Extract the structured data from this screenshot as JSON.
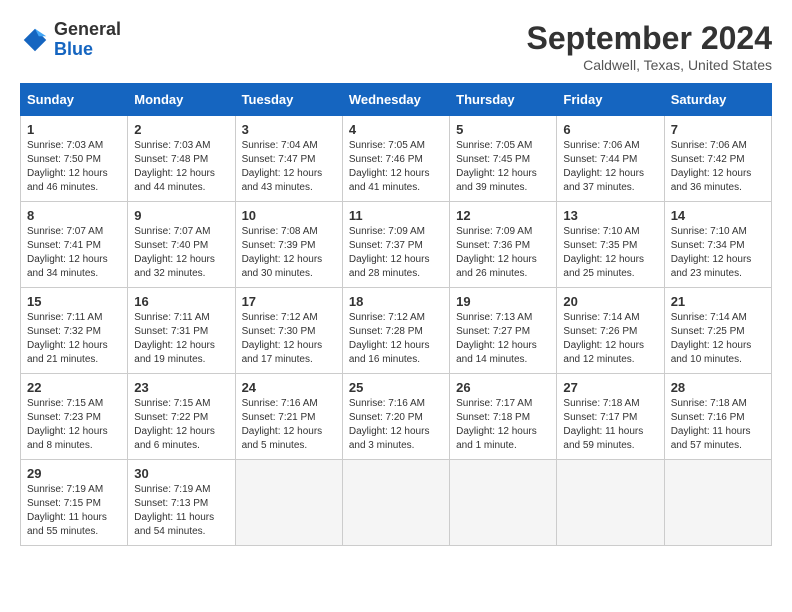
{
  "header": {
    "logo": {
      "general": "General",
      "blue": "Blue"
    },
    "title": "September 2024",
    "location": "Caldwell, Texas, United States"
  },
  "calendar": {
    "days_of_week": [
      "Sunday",
      "Monday",
      "Tuesday",
      "Wednesday",
      "Thursday",
      "Friday",
      "Saturday"
    ],
    "weeks": [
      [
        {
          "day": "1",
          "sunrise": "7:03 AM",
          "sunset": "7:50 PM",
          "daylight": "12 hours and 46 minutes."
        },
        {
          "day": "2",
          "sunrise": "7:03 AM",
          "sunset": "7:48 PM",
          "daylight": "12 hours and 44 minutes."
        },
        {
          "day": "3",
          "sunrise": "7:04 AM",
          "sunset": "7:47 PM",
          "daylight": "12 hours and 43 minutes."
        },
        {
          "day": "4",
          "sunrise": "7:05 AM",
          "sunset": "7:46 PM",
          "daylight": "12 hours and 41 minutes."
        },
        {
          "day": "5",
          "sunrise": "7:05 AM",
          "sunset": "7:45 PM",
          "daylight": "12 hours and 39 minutes."
        },
        {
          "day": "6",
          "sunrise": "7:06 AM",
          "sunset": "7:44 PM",
          "daylight": "12 hours and 37 minutes."
        },
        {
          "day": "7",
          "sunrise": "7:06 AM",
          "sunset": "7:42 PM",
          "daylight": "12 hours and 36 minutes."
        }
      ],
      [
        {
          "day": "8",
          "sunrise": "7:07 AM",
          "sunset": "7:41 PM",
          "daylight": "12 hours and 34 minutes."
        },
        {
          "day": "9",
          "sunrise": "7:07 AM",
          "sunset": "7:40 PM",
          "daylight": "12 hours and 32 minutes."
        },
        {
          "day": "10",
          "sunrise": "7:08 AM",
          "sunset": "7:39 PM",
          "daylight": "12 hours and 30 minutes."
        },
        {
          "day": "11",
          "sunrise": "7:09 AM",
          "sunset": "7:37 PM",
          "daylight": "12 hours and 28 minutes."
        },
        {
          "day": "12",
          "sunrise": "7:09 AM",
          "sunset": "7:36 PM",
          "daylight": "12 hours and 26 minutes."
        },
        {
          "day": "13",
          "sunrise": "7:10 AM",
          "sunset": "7:35 PM",
          "daylight": "12 hours and 25 minutes."
        },
        {
          "day": "14",
          "sunrise": "7:10 AM",
          "sunset": "7:34 PM",
          "daylight": "12 hours and 23 minutes."
        }
      ],
      [
        {
          "day": "15",
          "sunrise": "7:11 AM",
          "sunset": "7:32 PM",
          "daylight": "12 hours and 21 minutes."
        },
        {
          "day": "16",
          "sunrise": "7:11 AM",
          "sunset": "7:31 PM",
          "daylight": "12 hours and 19 minutes."
        },
        {
          "day": "17",
          "sunrise": "7:12 AM",
          "sunset": "7:30 PM",
          "daylight": "12 hours and 17 minutes."
        },
        {
          "day": "18",
          "sunrise": "7:12 AM",
          "sunset": "7:28 PM",
          "daylight": "12 hours and 16 minutes."
        },
        {
          "day": "19",
          "sunrise": "7:13 AM",
          "sunset": "7:27 PM",
          "daylight": "12 hours and 14 minutes."
        },
        {
          "day": "20",
          "sunrise": "7:14 AM",
          "sunset": "7:26 PM",
          "daylight": "12 hours and 12 minutes."
        },
        {
          "day": "21",
          "sunrise": "7:14 AM",
          "sunset": "7:25 PM",
          "daylight": "12 hours and 10 minutes."
        }
      ],
      [
        {
          "day": "22",
          "sunrise": "7:15 AM",
          "sunset": "7:23 PM",
          "daylight": "12 hours and 8 minutes."
        },
        {
          "day": "23",
          "sunrise": "7:15 AM",
          "sunset": "7:22 PM",
          "daylight": "12 hours and 6 minutes."
        },
        {
          "day": "24",
          "sunrise": "7:16 AM",
          "sunset": "7:21 PM",
          "daylight": "12 hours and 5 minutes."
        },
        {
          "day": "25",
          "sunrise": "7:16 AM",
          "sunset": "7:20 PM",
          "daylight": "12 hours and 3 minutes."
        },
        {
          "day": "26",
          "sunrise": "7:17 AM",
          "sunset": "7:18 PM",
          "daylight": "12 hours and 1 minute."
        },
        {
          "day": "27",
          "sunrise": "7:18 AM",
          "sunset": "7:17 PM",
          "daylight": "11 hours and 59 minutes."
        },
        {
          "day": "28",
          "sunrise": "7:18 AM",
          "sunset": "7:16 PM",
          "daylight": "11 hours and 57 minutes."
        }
      ],
      [
        {
          "day": "29",
          "sunrise": "7:19 AM",
          "sunset": "7:15 PM",
          "daylight": "11 hours and 55 minutes."
        },
        {
          "day": "30",
          "sunrise": "7:19 AM",
          "sunset": "7:13 PM",
          "daylight": "11 hours and 54 minutes."
        },
        null,
        null,
        null,
        null,
        null
      ]
    ]
  }
}
